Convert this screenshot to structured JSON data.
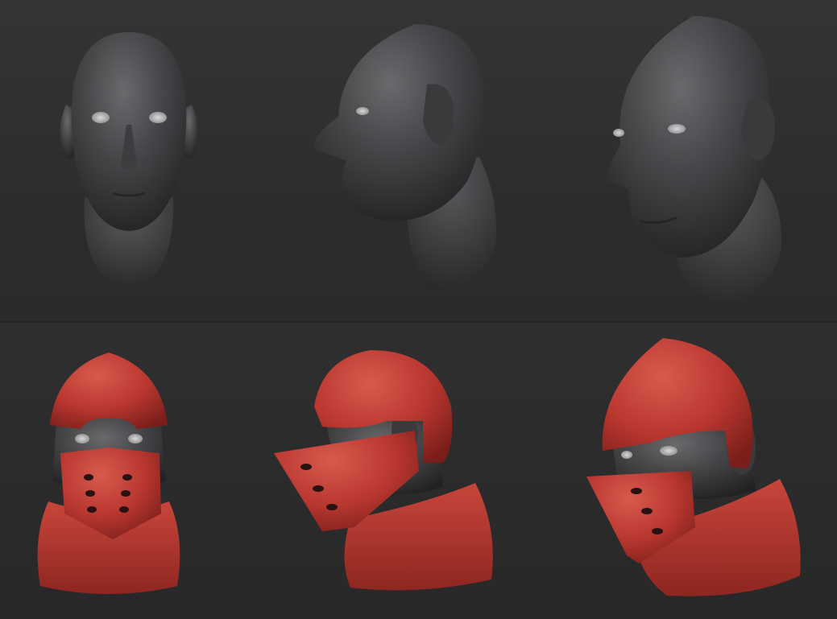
{
  "image": {
    "description_hidden": "",
    "colors": {
      "background_top": "#343435",
      "background_bottom": "#2a2a2b",
      "clay_dark": "#2b2b2d",
      "clay_light": "#6a6a6d",
      "armor_red": "#b8372f",
      "armor_highlight": "#d85a4e",
      "armor_shadow": "#7a1e1a"
    },
    "rows": [
      {
        "name": "bare-head-row",
        "views": [
          "front",
          "side",
          "three-quarter"
        ]
      },
      {
        "name": "helmet-row",
        "views": [
          "front",
          "side",
          "three-quarter"
        ]
      }
    ]
  }
}
